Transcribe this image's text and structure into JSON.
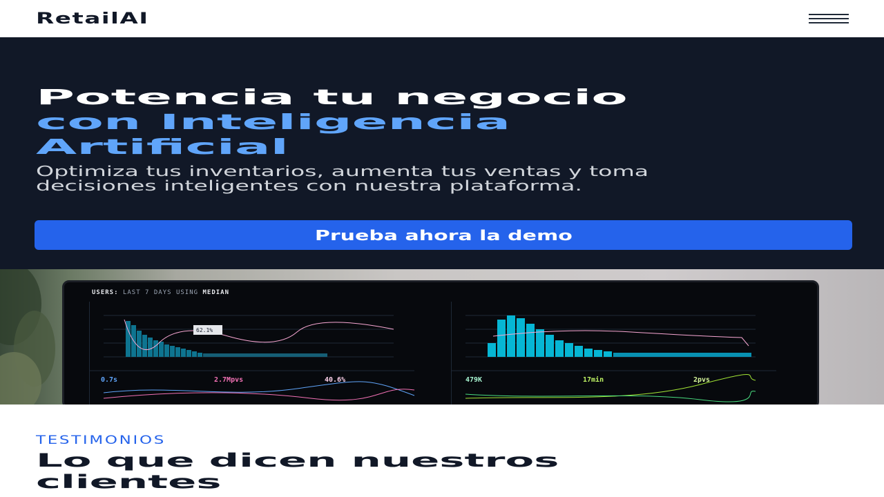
{
  "brand": {
    "name": "RetailAI"
  },
  "nav": {
    "menu_icon": "hamburger-menu-icon"
  },
  "hero": {
    "title_line1": "Potencia tu negocio",
    "title_line2": "con Inteligencia",
    "title_line3": "Artificial",
    "subtitle": "Optimiza tus inventarios, aumenta tus ventas y toma decisiones inteligentes con nuestra plataforma.",
    "cta_label": "Prueba ahora la demo",
    "accent_color": "#60a5fa",
    "button_color": "#2563eb",
    "background_color": "#111827"
  },
  "banner": {
    "screen_header_prefix": "USERS:",
    "screen_header_range": "LAST 7 DAYS",
    "screen_header_mid": "USING",
    "screen_header_metric": "MEDIAN",
    "tooltip": "62.1%",
    "stats_left": [
      "0.7s",
      "2.7Mpvs",
      "40.6%"
    ],
    "stats_right": [
      "479K",
      "17min",
      "2pvs"
    ]
  },
  "testimonials": {
    "eyebrow": "TESTIMONIOS",
    "title_line1": "Lo que dicen nuestros",
    "title_line2": "clientes"
  }
}
